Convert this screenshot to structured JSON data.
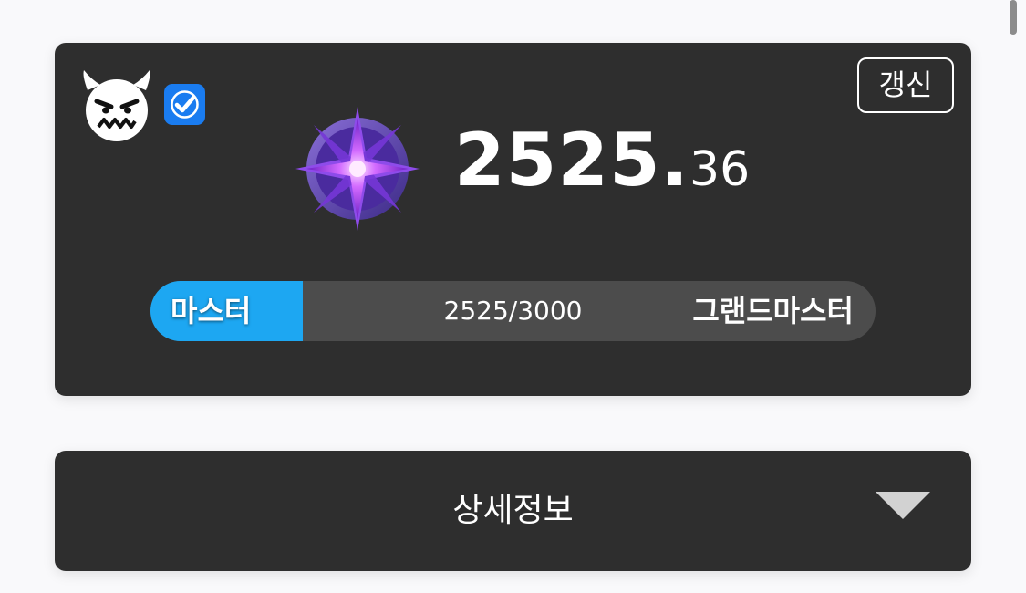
{
  "rank_card": {
    "verified": true,
    "refresh_label": "갱신",
    "rating_int": "2525.",
    "rating_frac": "36",
    "progress": {
      "current_tier": "마스터",
      "next_tier": "그랜드마스터",
      "points_text": "2525/3000",
      "fill_fraction": 0.21
    }
  },
  "detail_card": {
    "label": "상세정보"
  },
  "colors": {
    "card_bg": "#2e2e2e",
    "accent_blue": "#1da7f2",
    "verify_blue": "#1a7cf0",
    "emblem_purple": "#a24cf0"
  },
  "icons": {
    "avatar": "devil-face-icon",
    "verify": "checkbox-checked-icon",
    "emblem": "master-tier-crystal-icon",
    "expand": "triangle-down-icon"
  }
}
